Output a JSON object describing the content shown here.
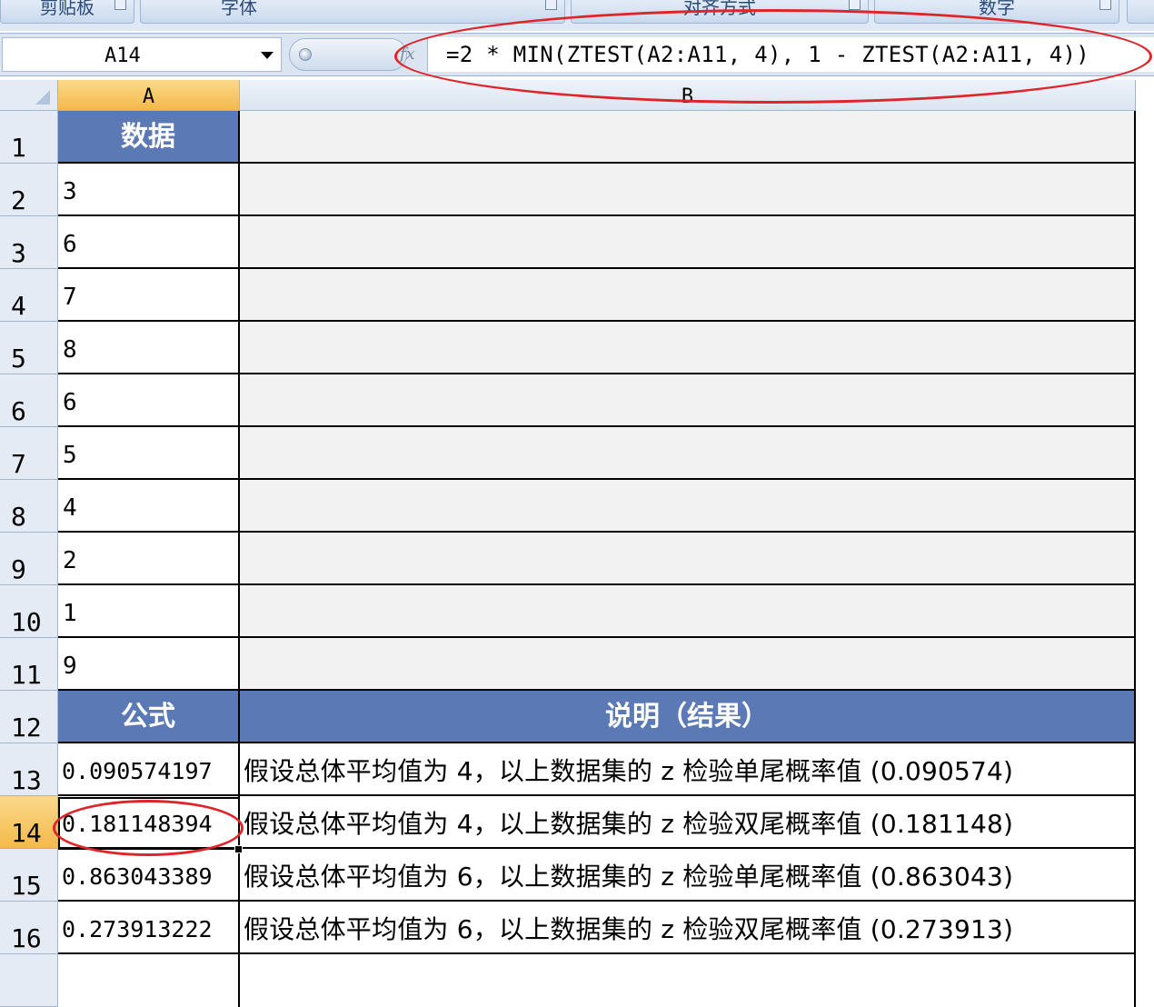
{
  "ribbon": {
    "groups": [
      "剪贴板",
      "字体",
      "对齐方式",
      "数字"
    ]
  },
  "formula_bar": {
    "name_box": "A14",
    "fx_icon": "fx-icon",
    "formula": "=2 * MIN(ZTEST(A2:A11, 4), 1 - ZTEST(A2:A11, 4))"
  },
  "columns": [
    "A",
    "B"
  ],
  "rows": [
    "1",
    "2",
    "3",
    "4",
    "5",
    "6",
    "7",
    "8",
    "9",
    "10",
    "11",
    "12",
    "13",
    "14",
    "15",
    "16"
  ],
  "sheet": {
    "header1": "数据",
    "data": [
      "3",
      "6",
      "7",
      "8",
      "6",
      "5",
      "4",
      "2",
      "1",
      "9"
    ],
    "header2_a": "公式",
    "header2_b": "说明（结果）",
    "results": [
      {
        "value": "0.090574197",
        "desc": "假设总体平均值为 4，以上数据集的 z 检验单尾概率值 (0.090574)"
      },
      {
        "value": "0.181148394",
        "desc": "假设总体平均值为 4，以上数据集的 z 检验双尾概率值 (0.181148)"
      },
      {
        "value": "0.863043389",
        "desc": "假设总体平均值为 6，以上数据集的 z 检验单尾概率值 (0.863043)"
      },
      {
        "value": "0.273913222",
        "desc": "假设总体平均值为 6，以上数据集的 z 检验双尾概率值 (0.273913)"
      }
    ]
  },
  "colors": {
    "header_fill": "#5b79b4",
    "active_header": "#f5b94a",
    "annotation": "#e0252a"
  }
}
